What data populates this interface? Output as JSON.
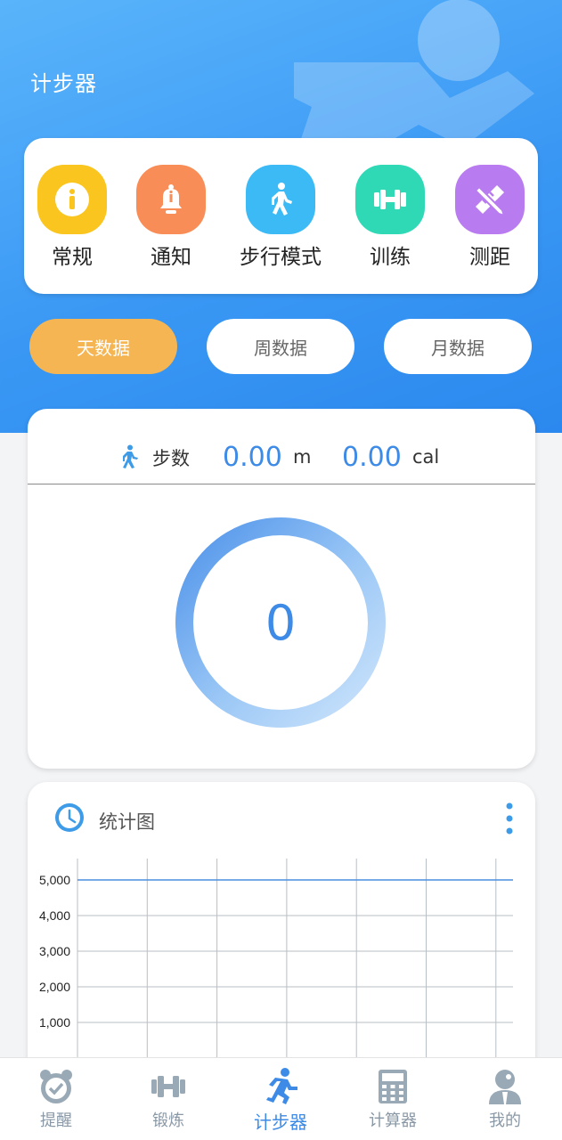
{
  "header": {
    "title": "计步器"
  },
  "menu": {
    "items": [
      {
        "label": "常规",
        "icon": "info-icon",
        "color": "#f9c51e"
      },
      {
        "label": "通知",
        "icon": "bell-icon",
        "color": "#f98d57"
      },
      {
        "label": "步行模式",
        "icon": "walking-icon",
        "color": "#3cbaf5"
      },
      {
        "label": "训练",
        "icon": "dumbbell-icon",
        "color": "#2fd9b6"
      },
      {
        "label": "测距",
        "icon": "ruler-pencil-icon",
        "color": "#b97cf0"
      }
    ]
  },
  "tabs": [
    {
      "label": "天数据",
      "active": true
    },
    {
      "label": "周数据",
      "active": false
    },
    {
      "label": "月数据",
      "active": false
    }
  ],
  "stats": {
    "steps_label": "步数",
    "distance_value": "0.00",
    "distance_unit": "m",
    "calorie_value": "0.00",
    "calorie_unit": "cal",
    "step_count": "0",
    "accent_color": "#3d8be6"
  },
  "chart_section": {
    "title": "统计图"
  },
  "chart_data": {
    "type": "line",
    "title": "",
    "xlabel": "",
    "ylabel": "",
    "y_ticks": [
      "1,000",
      "2,000",
      "3,000",
      "4,000",
      "5,000"
    ],
    "ylim": [
      0,
      5600
    ],
    "limit_line": 5000,
    "grid": true,
    "series": []
  },
  "bottom_nav": {
    "items": [
      {
        "label": "提醒",
        "icon": "alarm-clock-icon",
        "active": false
      },
      {
        "label": "锻炼",
        "icon": "dumbbell-icon",
        "active": false
      },
      {
        "label": "计步器",
        "icon": "runner-icon",
        "active": true
      },
      {
        "label": "计算器",
        "icon": "calculator-icon",
        "active": false
      },
      {
        "label": "我的",
        "icon": "user-icon",
        "active": false
      }
    ]
  }
}
